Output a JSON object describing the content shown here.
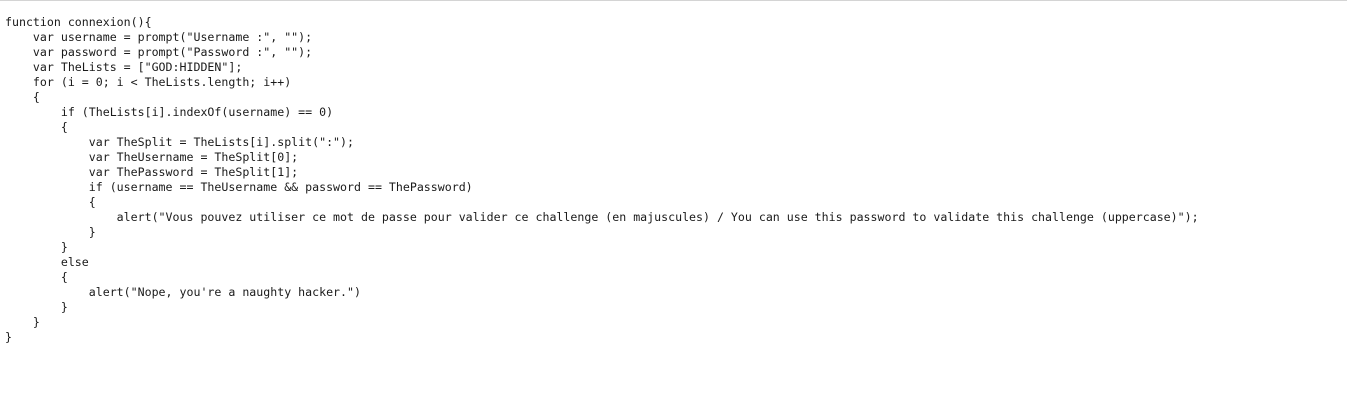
{
  "code": {
    "lines": [
      "function connexion(){",
      "    var username = prompt(\"Username :\", \"\");",
      "    var password = prompt(\"Password :\", \"\");",
      "    var TheLists = [\"GOD:HIDDEN\"];",
      "    for (i = 0; i < TheLists.length; i++)",
      "    {",
      "        if (TheLists[i].indexOf(username) == 0)",
      "        {",
      "            var TheSplit = TheLists[i].split(\":\");",
      "            var TheUsername = TheSplit[0];",
      "            var ThePassword = TheSplit[1];",
      "            if (username == TheUsername && password == ThePassword)",
      "            {",
      "                alert(\"Vous pouvez utiliser ce mot de passe pour valider ce challenge (en majuscules) / You can use this password to validate this challenge (uppercase)\");",
      "            }",
      "        }",
      "        else",
      "        {",
      "            alert(\"Nope, you're a naughty hacker.\")",
      "        }",
      "    }",
      "}"
    ]
  }
}
